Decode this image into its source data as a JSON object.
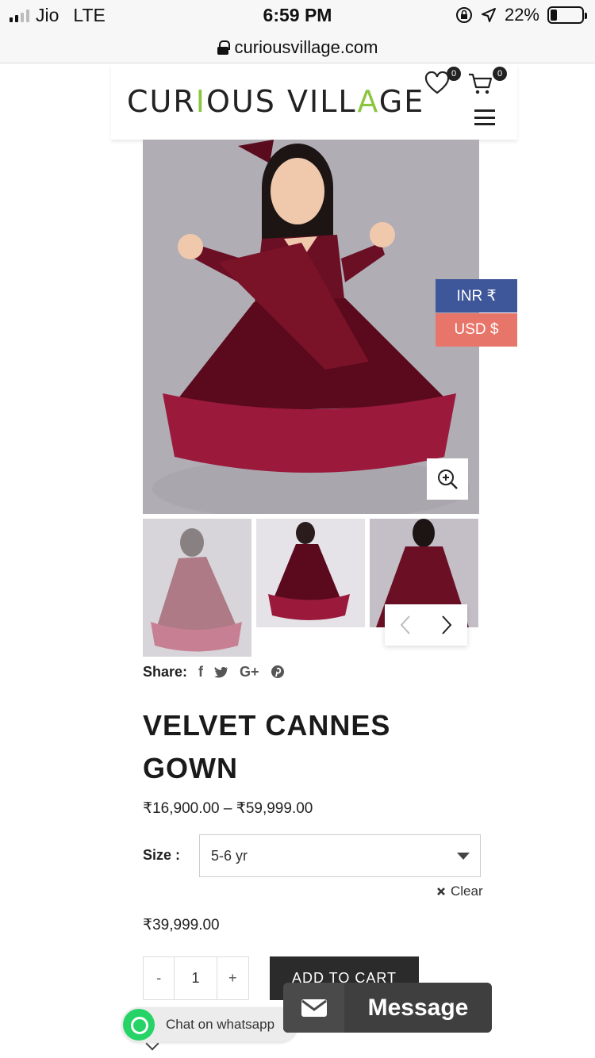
{
  "status_bar": {
    "carrier": "Jio",
    "network": "LTE",
    "time": "6:59 PM",
    "battery": "22%",
    "battery_level": 0.22
  },
  "browser": {
    "url": "curiousvillage.com"
  },
  "header": {
    "logo": "CURIOUS VILLAGE",
    "wishlist_count": "0",
    "cart_count": "0"
  },
  "currency": {
    "inr": "INR ₹",
    "usd": "USD $"
  },
  "share": {
    "label": "Share:",
    "icons": [
      "facebook-icon",
      "twitter-icon",
      "google-plus-icon",
      "pinterest-icon"
    ],
    "f": "f",
    "g": "G+",
    "p": "℗"
  },
  "product": {
    "title": "VELVET CANNES GOWN",
    "price_range": "₹16,900.00 – ₹59,999.00",
    "size_label": "Size :",
    "size_value": "5-6 yr",
    "clear_label": "Clear",
    "price": "₹39,999.00",
    "quantity": "1",
    "minus": "-",
    "plus": "+",
    "add_to_cart": "ADD TO CART"
  },
  "chat": {
    "whatsapp_label": "Chat on whatsapp",
    "message_label": "Message"
  },
  "colors": {
    "inr_bg": "#3e579a",
    "usd_bg": "#e8756a",
    "logo_accent": "#8cc63f",
    "dress": "#6b0f24",
    "tulle": "#9b1a3c"
  }
}
